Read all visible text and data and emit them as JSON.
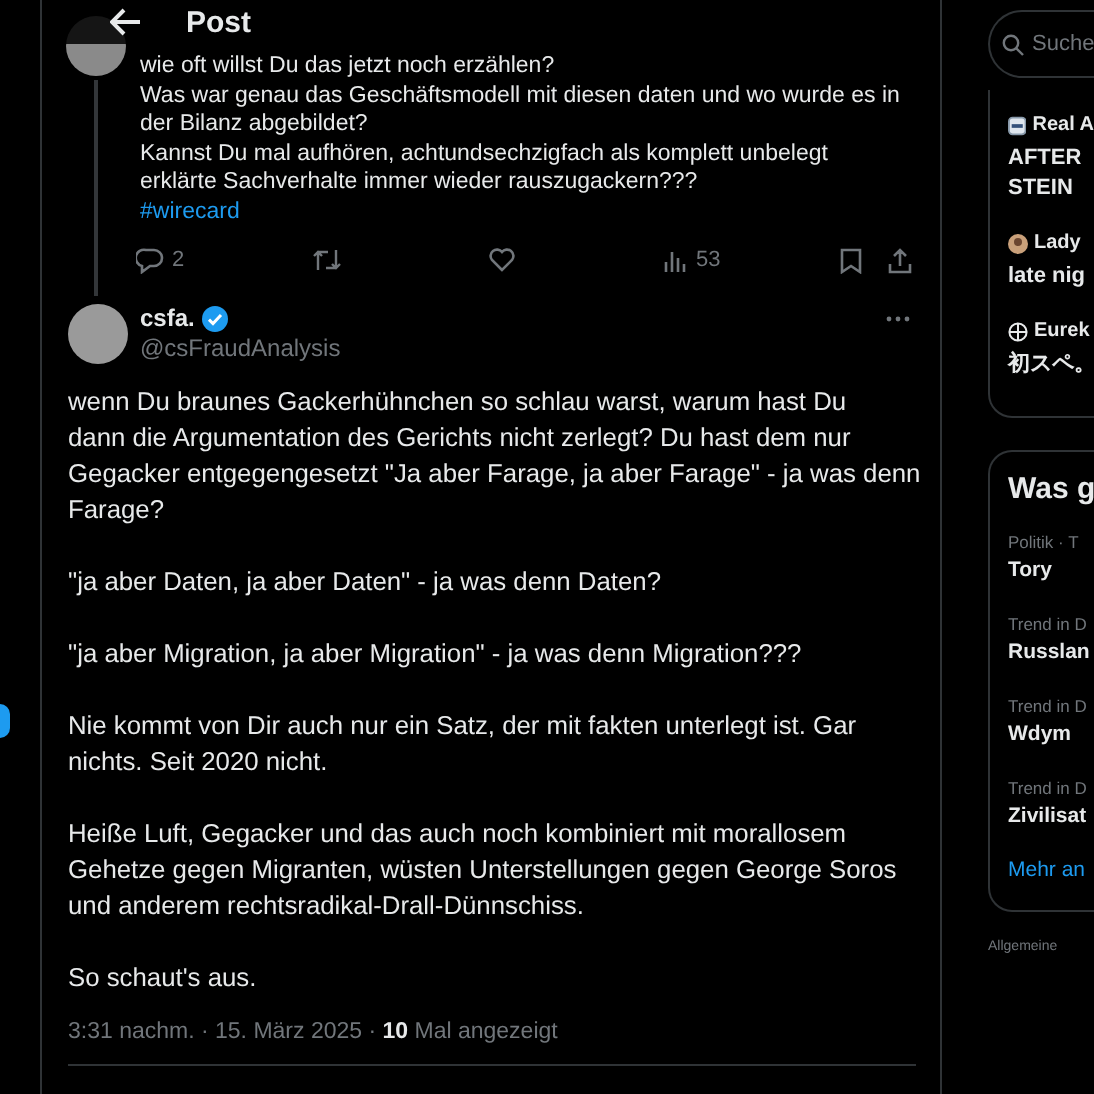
{
  "header": {
    "title": "Post"
  },
  "parent_post": {
    "lines": [
      "wie oft willst Du das jetzt noch erzählen?",
      "Was war genau das Geschäftsmodell mit diesen daten und wo wurde es in",
      "der Bilanz abgebildet?",
      "Kannst Du mal aufhören, achtundsechzigfach als komplett unbelegt",
      "erklärte Sachverhalte immer wieder rauszugackern???"
    ],
    "hashtag": "#wirecard",
    "actions": [
      {
        "kind": "reply",
        "count": "2"
      },
      {
        "kind": "repost"
      },
      {
        "kind": "like"
      },
      {
        "kind": "views",
        "count": "53"
      },
      {
        "kind": "bookmark"
      },
      {
        "kind": "share"
      }
    ]
  },
  "post": {
    "name": "csfa.",
    "verified": true,
    "handle": "@csFraudAnalysis",
    "paragraphs": [
      [
        "wenn Du braunes Gackerhühnchen so schlau warst, warum hast Du",
        "dann die Argumentation des Gerichts nicht zerlegt? Du hast dem nur",
        "Gegacker entgegengesetzt \"Ja aber Farage, ja aber Farage\" - ja was denn",
        "Farage?"
      ],
      [
        "\"ja aber Daten, ja aber Daten\" - ja was denn Daten?"
      ],
      [
        "\"ja aber Migration, ja aber Migration\" - ja was denn Migration???"
      ],
      [
        "Nie kommt von Dir auch nur ein Satz, der mit fakten unterlegt ist. Gar",
        "nichts. Seit 2020 nicht."
      ],
      [
        "Heiße Luft, Gegacker und das auch noch kombiniert mit morallosem",
        "Gehetze gegen Migranten, wüsten Unterstellungen gegen George Soros",
        "und anderem rechtsradikal-Drall-Dünnschiss."
      ],
      [
        "So schaut's aus."
      ]
    ],
    "timestamp": "3:31 nachm. · 15. März 2025 · **10** Mal angezeigt"
  },
  "sidebar": {
    "search": {
      "placeholder": "Suche"
    },
    "news": [
      {
        "source": "Real A",
        "kind": "logo",
        "headline": [
          "AFTER",
          "STEIN"
        ]
      },
      {
        "source": "Lady",
        "kind": "avatar",
        "headline": [
          "late nig"
        ]
      },
      {
        "source": "Eurek",
        "kind": "globe",
        "headline": [
          "初スペ。"
        ]
      }
    ],
    "trends": {
      "title": "Was g",
      "items": [
        {
          "category": "Politik · T",
          "name": "Tory"
        },
        {
          "category": "Trend in D",
          "name": "Russlan"
        },
        {
          "category": "Trend in D",
          "name": "Wdym"
        },
        {
          "category": "Trend in D",
          "name": "Zivilisat"
        }
      ],
      "more": "Mehr an"
    },
    "footer": "Allgemeine"
  }
}
